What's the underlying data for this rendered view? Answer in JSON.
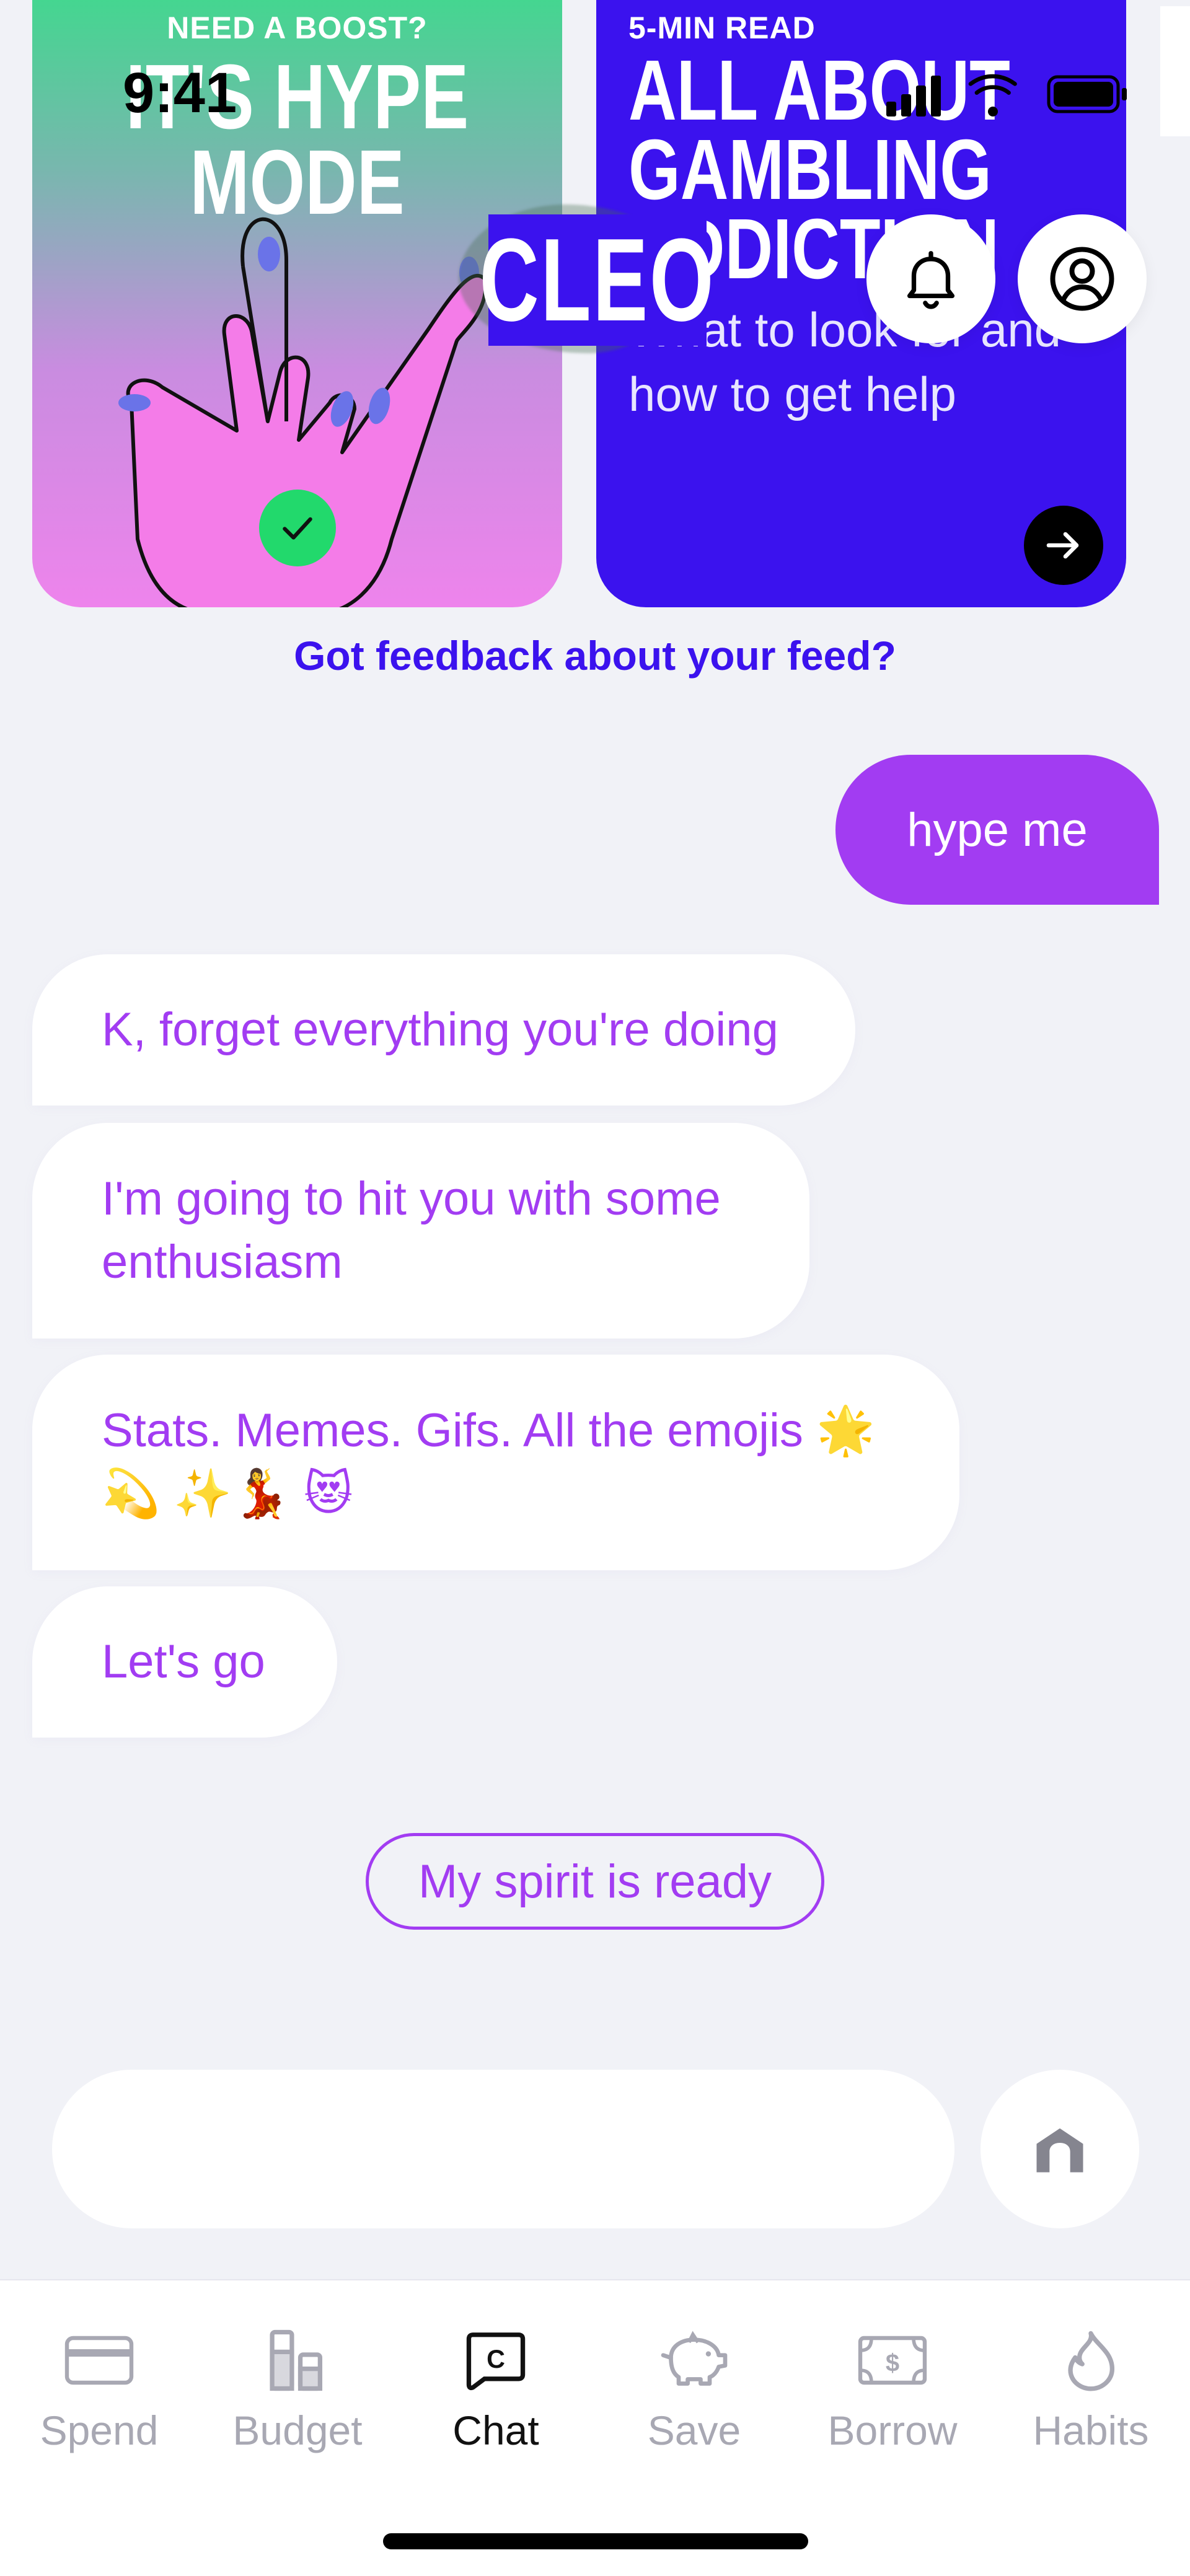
{
  "status_bar": {
    "time": "9:41"
  },
  "feed": {
    "cards": [
      {
        "kicker": "NEED A BOOST?",
        "headline_line1": "IT'S HYPE",
        "headline_line2": "MODE"
      },
      {
        "kicker": "5-MIN READ",
        "headline_line1": "ALL ABOUT",
        "headline_line2": "GAMBLING",
        "headline_line3": "ADDICTION",
        "description": "What to look for and how to get help"
      }
    ],
    "feedback_link": "Got feedback about your feed?"
  },
  "header": {
    "logo": "CLEO"
  },
  "chat": {
    "user_message": "hype me",
    "bot_messages": [
      "K, forget everything you're doing",
      "I'm going to hit you with some enthusiasm",
      "Stats. Memes. Gifs. All the emojis 🌟 💫 ✨💃 😻",
      "Let's go"
    ],
    "quick_reply": "My spirit is ready"
  },
  "tabs": [
    {
      "label": "Spend",
      "icon": "card-icon"
    },
    {
      "label": "Budget",
      "icon": "budget-icon"
    },
    {
      "label": "Chat",
      "icon": "chat-icon"
    },
    {
      "label": "Save",
      "icon": "piggy-bank-icon"
    },
    {
      "label": "Borrow",
      "icon": "cash-icon"
    },
    {
      "label": "Habits",
      "icon": "flame-icon"
    }
  ],
  "active_tab": "Chat",
  "colors": {
    "accent_purple": "#a23cf2",
    "brand_blue": "#3b12ee",
    "check_green": "#22d96c"
  }
}
